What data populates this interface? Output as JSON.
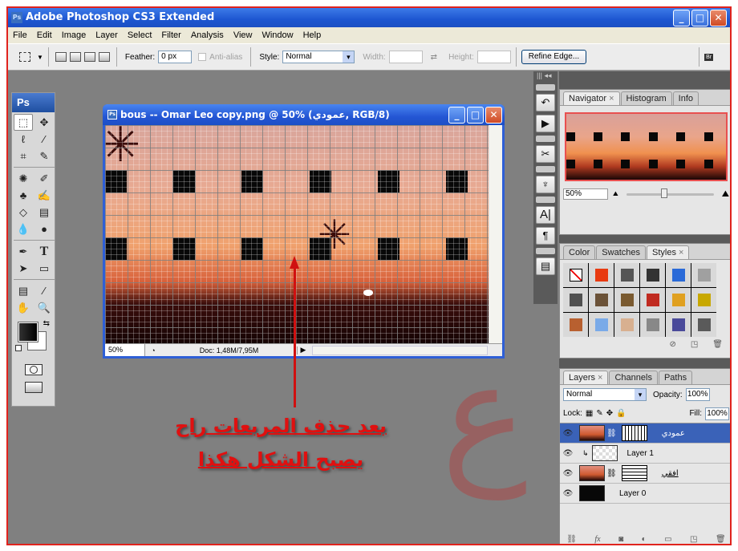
{
  "app": {
    "title": "Adobe Photoshop CS3 Extended",
    "window_controls": {
      "minimize": "_",
      "maximize": "□",
      "close": "✕"
    }
  },
  "menu": [
    "File",
    "Edit",
    "Image",
    "Layer",
    "Select",
    "Filter",
    "Analysis",
    "View",
    "Window",
    "Help"
  ],
  "options_bar": {
    "feather_label": "Feather:",
    "feather_value": "0 px",
    "anti_alias_label": "Anti-alias",
    "style_label": "Style:",
    "style_value": "Normal",
    "width_label": "Width:",
    "height_label": "Height:",
    "refine_edge_label": "Refine Edge...",
    "bridge_icon_label": "Br"
  },
  "toolbox": {
    "logo": "Ps",
    "tools": [
      "marquee",
      "move",
      "lasso",
      "magic-wand",
      "crop",
      "slice",
      "healing",
      "brush",
      "stamp",
      "history-brush",
      "eraser",
      "gradient",
      "blur",
      "dodge",
      "pen",
      "type",
      "path-select",
      "shape",
      "notes",
      "eyedropper",
      "hand",
      "zoom"
    ],
    "foreground_color": "#000000",
    "background_color": "#ffffff"
  },
  "document": {
    "title": "bous -- Omar Leo copy.png @ 50% (عمودي, RGB/8)",
    "zoom": "50%",
    "doc_info": "Doc: 1,48M/7,95M"
  },
  "annotation": {
    "line1": "بعد حذف المربعات راح",
    "line2": "يصبح الشكل هكذا",
    "color": "#e01010"
  },
  "navigator_panel": {
    "tabs": [
      {
        "label": "Navigator",
        "active": true
      },
      {
        "label": "Histogram",
        "active": false
      },
      {
        "label": "Info",
        "active": false
      }
    ],
    "zoom": "50%"
  },
  "styles_panel": {
    "tabs": [
      {
        "label": "Color",
        "active": false
      },
      {
        "label": "Swatches",
        "active": false
      },
      {
        "label": "Styles",
        "active": true
      }
    ],
    "swatches": [
      "none",
      "#e83a10",
      "#555555",
      "#333333",
      "#2a6ad8",
      "#a0a0a0",
      "#505050",
      "#6b5238",
      "#7a5a30",
      "#c02a20",
      "#e0a020",
      "#c8a800",
      "#b86030",
      "#7aaae8",
      "#d8b090",
      "#888888",
      "#4a4a9a",
      "#5a5a5a"
    ]
  },
  "layers_panel": {
    "tabs": [
      {
        "label": "Layers",
        "active": true
      },
      {
        "label": "Channels",
        "active": false
      },
      {
        "label": "Paths",
        "active": false
      }
    ],
    "blend_mode": "Normal",
    "opacity_label": "Opacity:",
    "opacity": "100%",
    "lock_label": "Lock:",
    "fill_label": "Fill:",
    "fill": "100%",
    "layers": [
      {
        "name": "عمودي",
        "selected": true,
        "mask": "vertical"
      },
      {
        "name": "Layer 1",
        "selected": false,
        "mask": "none",
        "clipped": true
      },
      {
        "name": "افقي",
        "selected": false,
        "mask": "horizontal"
      },
      {
        "name": "Layer 0",
        "selected": false,
        "mask": "none"
      }
    ]
  }
}
